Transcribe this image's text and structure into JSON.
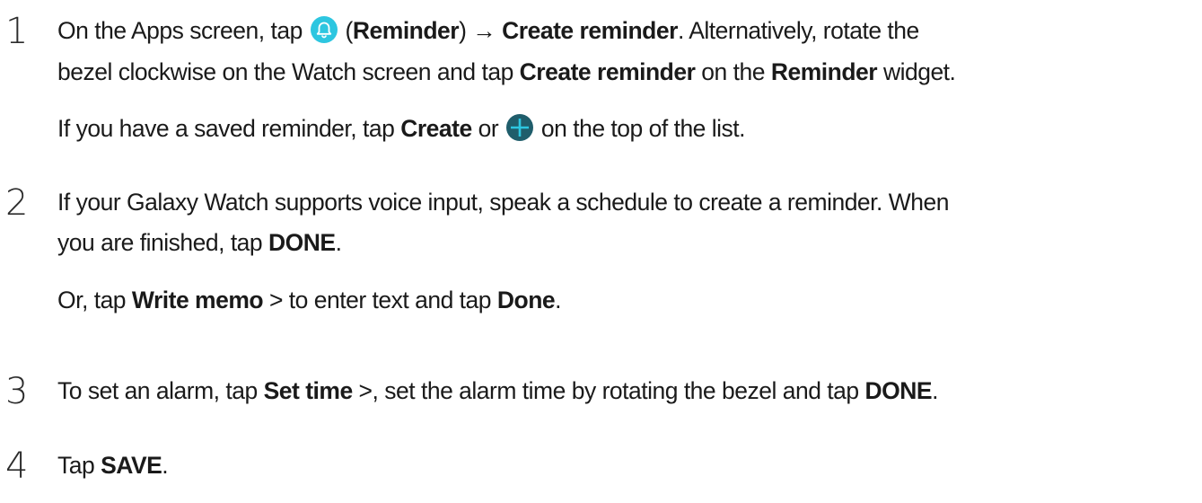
{
  "steps": [
    {
      "number": "1",
      "line1": {
        "t1": "On the Apps screen, tap ",
        "icon": "reminder-bell-icon",
        "t2": " (",
        "b1": "Reminder",
        "t3": ") → ",
        "b2": "Create reminder",
        "t4": ". Alternatively, rotate the"
      },
      "line2": {
        "t1": "bezel clockwise on the Watch screen and tap ",
        "b1": "Create reminder",
        "t2": " on the ",
        "b2": "Reminder",
        "t3": " widget."
      },
      "line3": {
        "t1": "If you have a saved reminder, tap ",
        "b1": "Create",
        "t2": " or ",
        "icon": "plus-circle-icon",
        "t3": " on the top of the list."
      }
    },
    {
      "number": "2",
      "line1": {
        "t1": "If your Galaxy Watch supports voice input, speak a schedule to create a reminder. When"
      },
      "line2": {
        "t1": "you are finished, tap ",
        "b1": "DONE",
        "t2": "."
      },
      "line3": {
        "t1": "Or, tap ",
        "b1": "Write memo",
        "t2": " > to enter text and tap ",
        "b2": "Done",
        "t3": "."
      }
    },
    {
      "number": "3",
      "line1": {
        "t1": "To set an alarm, tap ",
        "b1": "Set time",
        "t2": " >, set the alarm time by rotating the bezel and tap ",
        "b2": "DONE",
        "t3": "."
      }
    },
    {
      "number": "4",
      "line1": {
        "t1": "Tap ",
        "b1": "SAVE",
        "t2": "."
      }
    }
  ],
  "colors": {
    "bell_icon": "#2dc6e0",
    "plus_icon": "#1f5d6b",
    "text": "#1a1a1a"
  }
}
